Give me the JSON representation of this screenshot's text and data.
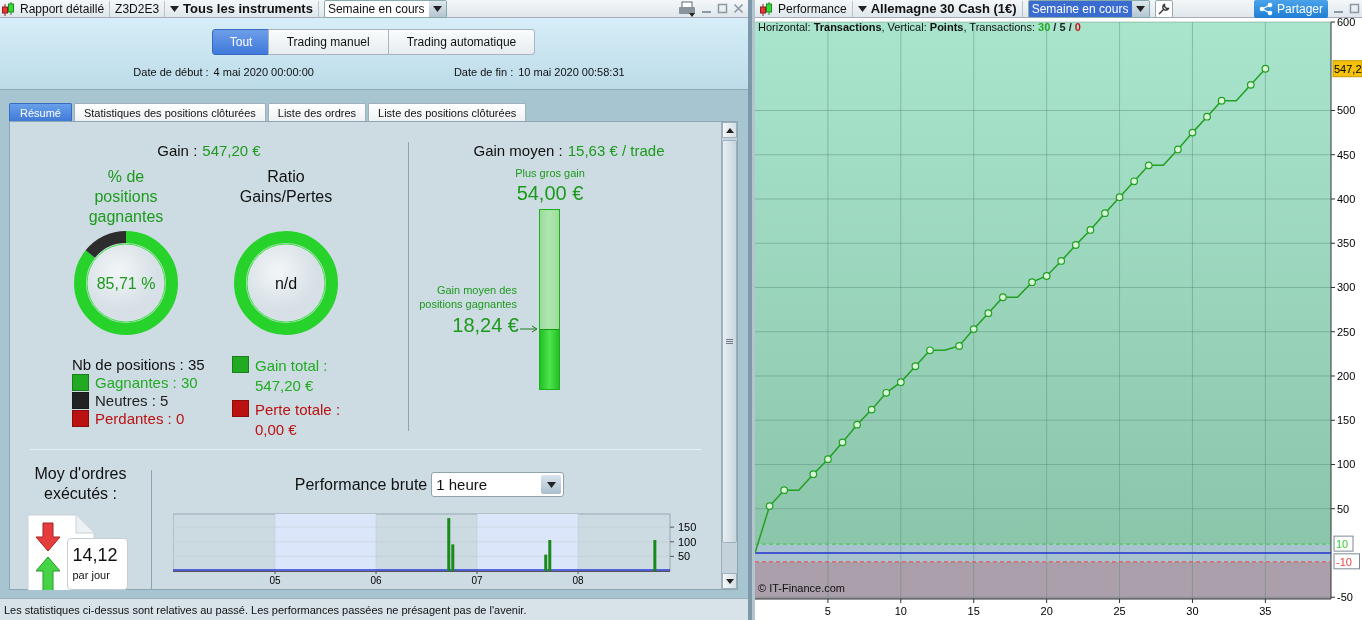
{
  "left_toolbar": {
    "title": "Rapport détaillé",
    "account": "Z3D2E3",
    "instrument": "Tous les instruments",
    "period": {
      "value": "Semaine en cours",
      "focused": false
    }
  },
  "filter_buttons": [
    {
      "label": "Tout",
      "selected": true
    },
    {
      "label": "Trading manuel",
      "selected": false
    },
    {
      "label": "Trading automatique",
      "selected": false
    }
  ],
  "dates": [
    {
      "label": "Date de début :",
      "value": "4 mai 2020 00:00:00"
    },
    {
      "label": "Date de fin :",
      "value": "10 mai 2020 00:58:31"
    }
  ],
  "tabs": [
    {
      "label": "Résumé",
      "selected": true
    },
    {
      "label": "Statistiques des positions clôturées",
      "selected": false
    },
    {
      "label": "Liste des ordres",
      "selected": false
    },
    {
      "label": "Liste des positions clôturées",
      "selected": false
    }
  ],
  "summary": {
    "gain_label": "Gain :",
    "gain_value": "547,20 €",
    "win_rate": {
      "title": "% de positions gagnantes",
      "value": "85,71 %",
      "level": 0.8571
    },
    "ratio": {
      "title": "Ratio Gains/Pertes",
      "value": "n/d"
    },
    "positions_label": "Nb de positions : 35",
    "positions": [
      {
        "label": "Gagnantes : 30",
        "color": "#22aa22"
      },
      {
        "label": "Neutres : 5",
        "color": "#222222"
      },
      {
        "label": "Perdantes : 0",
        "color": "#bb1111"
      }
    ],
    "totals": [
      {
        "label": "Gain total : 547,20 €",
        "color": "#22aa22"
      },
      {
        "label": "Perte totale : 0,00 €",
        "color": "#bb1111"
      }
    ],
    "average": {
      "label": "Gain moyen :",
      "value": "15,63 € / trade",
      "max_label": "Plus gros gain",
      "max_value": "54,00 €",
      "avg_win_label": "Gain moyen des positions gagnantes",
      "avg_win_value": "18,24 €",
      "level": 0.338
    }
  },
  "orders": {
    "title": "Moy d'ordres exécutés :",
    "value": "14,12",
    "unit": "par jour"
  },
  "raw_performance": {
    "title": "Performance brute",
    "interval": "1 heure",
    "chart_data": {
      "type": "bar",
      "x": [
        6.72,
        6.76,
        7.68,
        7.72,
        8.76
      ],
      "values": [
        181,
        91,
        56,
        106,
        106
      ],
      "xlim": [
        3.99,
        8.91
      ],
      "ylim": [
        0,
        195
      ],
      "grid": true,
      "xticks": [
        {
          "value": 5,
          "label": "05"
        },
        {
          "value": 6,
          "label": "06"
        },
        {
          "value": 7,
          "label": "07"
        },
        {
          "value": 8,
          "label": "08"
        }
      ],
      "yticks": [
        {
          "value": 50,
          "label": "50"
        },
        {
          "value": 100,
          "label": "100"
        },
        {
          "value": 150,
          "label": "150"
        }
      ]
    }
  },
  "status_bar": "Les statistiques ci-dessus sont relatives au passé. Les performances passées ne présagent pas de l'avenir.",
  "right_toolbar": {
    "title": "Performance",
    "instrument": "Allemagne 30 Cash (1€)",
    "period": {
      "value": "Semaine en cours",
      "focused": true
    },
    "share": "Partager"
  },
  "equity": {
    "legend": "Horizontal: **Transactions**, Vertical: **Points**, Transactions:",
    "counts": [
      {
        "text": "30",
        "color": "#22aa22"
      },
      {
        "text": "/",
        "color": "#222222"
      },
      {
        "text": "5",
        "color": "#222222"
      },
      {
        "text": "/",
        "color": "#222222"
      },
      {
        "text": "0",
        "color": "#cc1111"
      }
    ],
    "copyright": "© IT-Finance.com",
    "chart_data": {
      "type": "line",
      "x": [
        0,
        1,
        2,
        3,
        4,
        5,
        6,
        7,
        8,
        9,
        10,
        11,
        12,
        13,
        14,
        15,
        16,
        17,
        18,
        19,
        20,
        21,
        22,
        23,
        24,
        25,
        26,
        27,
        28,
        29,
        30,
        31,
        32,
        33,
        34,
        35
      ],
      "grid": true,
      "series": [
        {
          "color": "#22a022",
          "marker": "circle",
          "values": [
            0,
            53,
            71,
            71,
            89,
            106,
            125,
            145,
            162,
            181,
            193,
            211,
            229,
            229,
            234,
            253,
            271,
            289,
            289,
            306,
            313,
            330,
            348,
            365,
            384,
            402,
            420,
            438,
            438,
            456,
            475,
            493,
            511,
            511,
            529,
            547.2
          ]
        }
      ],
      "xlim": [
        0,
        39.5
      ],
      "ylim": [
        -52,
        600
      ],
      "xticks": [
        {
          "value": 5,
          "label": "5"
        },
        {
          "value": 10,
          "label": "10"
        },
        {
          "value": 15,
          "label": "15"
        },
        {
          "value": 20,
          "label": "20"
        },
        {
          "value": 25,
          "label": "25"
        },
        {
          "value": 30,
          "label": "30"
        },
        {
          "value": 35,
          "label": "35"
        }
      ],
      "yticks": [
        {
          "value": -50,
          "label": "-50"
        },
        {
          "value": 50,
          "label": "50"
        },
        {
          "value": 100,
          "label": "100"
        },
        {
          "value": 150,
          "label": "150"
        },
        {
          "value": 200,
          "label": "200"
        },
        {
          "value": 250,
          "label": "250"
        },
        {
          "value": 300,
          "label": "300"
        },
        {
          "value": 350,
          "label": "350"
        },
        {
          "value": 400,
          "label": "400"
        },
        {
          "value": 450,
          "label": "450"
        },
        {
          "value": 500,
          "label": "500"
        },
        {
          "value": 600,
          "label": "600"
        }
      ],
      "ref_lines": [
        {
          "axis": "y",
          "value": 10,
          "label": "10",
          "color": "#33cc33"
        },
        {
          "axis": "y",
          "value": -10,
          "label": "-10",
          "color": "#ee4444"
        },
        {
          "axis": "y",
          "value": 0,
          "color": "#2233cc"
        }
      ],
      "bands": [
        {
          "axis": "y",
          "from": -10,
          "to": 10,
          "color": "#a7c3cf"
        },
        {
          "axis": "y",
          "from": -52,
          "to": -10,
          "color": "#ab9fab"
        }
      ],
      "annotations": [
        {
          "y": 547.2,
          "text": "547,2"
        }
      ]
    }
  }
}
